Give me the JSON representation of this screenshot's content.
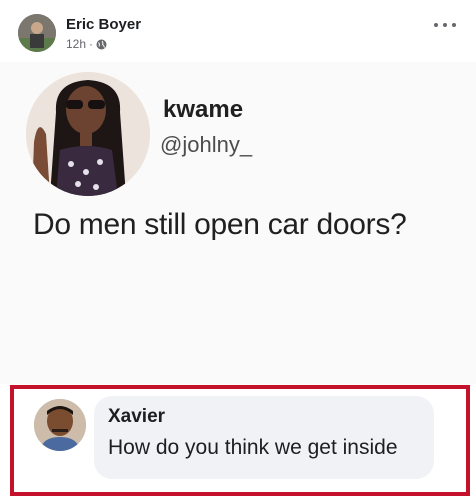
{
  "post": {
    "author": "Eric Boyer",
    "timestamp": "12h",
    "separator": "·",
    "privacy_icon": "globe-icon",
    "more_icon": "more-options-icon"
  },
  "tweet": {
    "name": "kwame",
    "handle": "@johlny_",
    "text": "Do men still open car doors?"
  },
  "comment": {
    "author": "Xavier",
    "text": "How do you think we get inside",
    "highlight_color": "#c4112c"
  }
}
